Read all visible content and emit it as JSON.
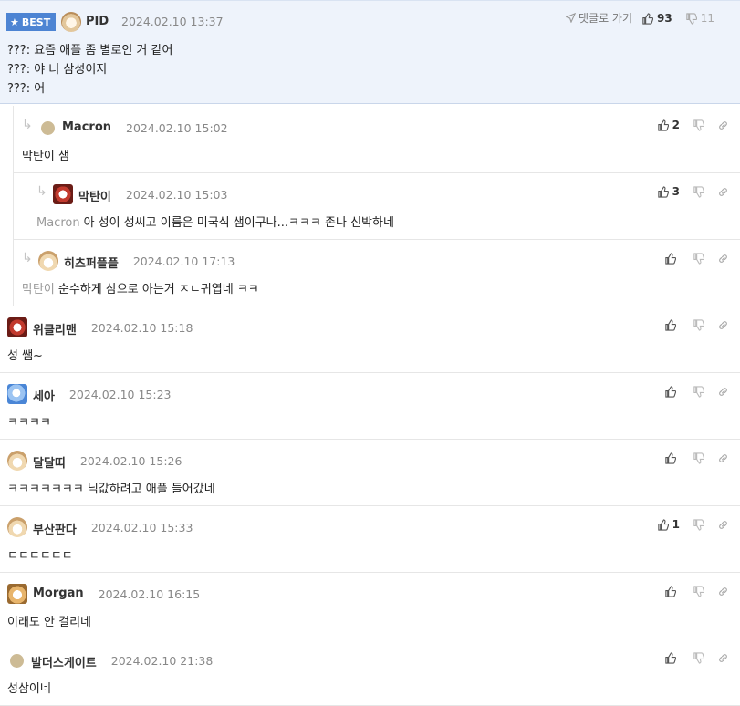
{
  "best": {
    "badge": "BEST",
    "nick": "PID",
    "date": "2024.02.10 13:37",
    "goto": "댓글로 가기",
    "up": "93",
    "down": "11",
    "lines": [
      "???: 요즘 애플 좀 별로인 거 같어",
      "???: 야 너 삼성이지",
      "???: 어"
    ]
  },
  "comments": [
    {
      "nick": "Macron",
      "date": "2024.02.10 15:02",
      "mention": "",
      "text": "막탄이 샘",
      "up": "2"
    },
    {
      "nick": "막탄이",
      "date": "2024.02.10 15:03",
      "mention": "Macron",
      "text": "아 성이 성씨고 이름은 미국식 샘이구나...ㅋㅋㅋ 존나 신박하네",
      "up": "3"
    },
    {
      "nick": "히츠퍼플플",
      "date": "2024.02.10 17:13",
      "mention": "막탄이",
      "text": "순수하게 삼으로 아는거 ㅈㄴ귀엽네 ㅋㅋ",
      "up": ""
    },
    {
      "nick": "위클리맨",
      "date": "2024.02.10 15:18",
      "mention": "",
      "text": "성 쌤~",
      "up": ""
    },
    {
      "nick": "세아",
      "date": "2024.02.10 15:23",
      "mention": "",
      "text": "ㅋㅋㅋㅋ",
      "up": ""
    },
    {
      "nick": "달달띠",
      "date": "2024.02.10 15:26",
      "mention": "",
      "text": "ㅋㅋㅋㅋㅋㅋㅋ 닉값하려고 애플 들어갔네",
      "up": ""
    },
    {
      "nick": "부산판다",
      "date": "2024.02.10 15:33",
      "mention": "",
      "text": "ㄷㄷㄷㄷㄷㄷ",
      "up": "1"
    },
    {
      "nick": "Morgan",
      "date": "2024.02.10 16:15",
      "mention": "",
      "text": "이래도 안 걸리네",
      "up": ""
    },
    {
      "nick": "발더스게이트",
      "date": "2024.02.10 21:38",
      "mention": "",
      "text": "성삼이네",
      "up": ""
    }
  ]
}
